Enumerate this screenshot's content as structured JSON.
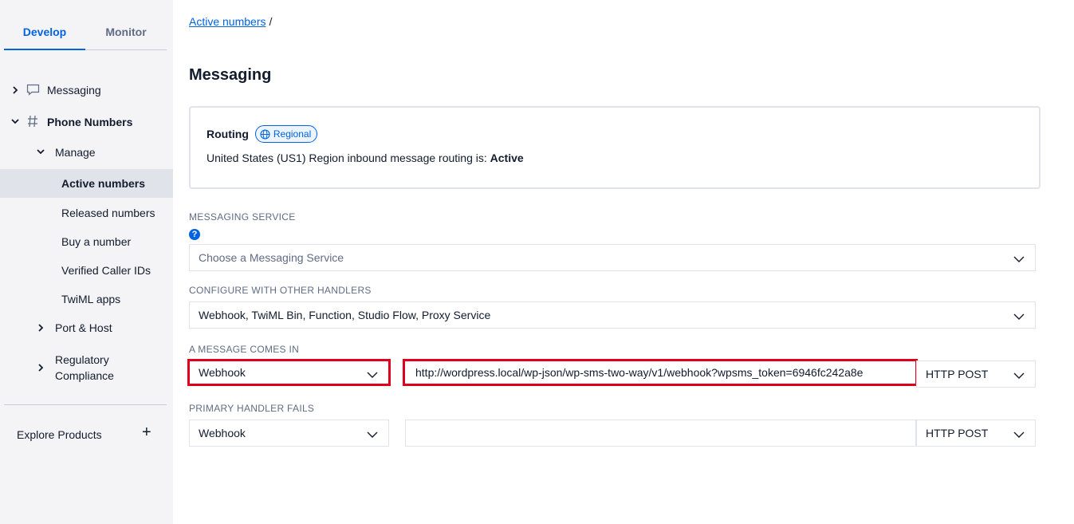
{
  "sidebar": {
    "tabs": [
      {
        "label": "Develop",
        "active": true
      },
      {
        "label": "Monitor",
        "active": false
      }
    ],
    "messaging": "Messaging",
    "phone_numbers": "Phone Numbers",
    "manage": "Manage",
    "active_numbers": "Active numbers",
    "released_numbers": "Released numbers",
    "buy_number": "Buy a number",
    "verified_caller_ids": "Verified Caller IDs",
    "twiml_apps": "TwiML apps",
    "port_host": "Port & Host",
    "regulatory_line1": "Regulatory",
    "regulatory_line2": "Compliance",
    "explore_products": "Explore Products",
    "plus_glyph": "+"
  },
  "breadcrumb": {
    "link": "Active numbers",
    "separator": "/"
  },
  "page_title": "Messaging",
  "routing": {
    "title": "Routing",
    "badge": "Regional",
    "description_prefix": "United States (US1) Region inbound message routing is: ",
    "status": "Active"
  },
  "messaging_service": {
    "label": "MESSAGING SERVICE",
    "help_glyph": "?",
    "placeholder": "Choose a Messaging Service"
  },
  "other_handlers": {
    "label": "CONFIGURE WITH OTHER HANDLERS",
    "value": "Webhook, TwiML Bin, Function, Studio Flow, Proxy Service"
  },
  "message_comes_in": {
    "label": "A MESSAGE COMES IN",
    "type": "Webhook",
    "url": "http://wordpress.local/wp-json/wp-sms-two-way/v1/webhook?wpsms_token=6946fc242a8e",
    "method": "HTTP POST"
  },
  "primary_handler_fails": {
    "label": "PRIMARY HANDLER FAILS",
    "type": "Webhook",
    "url": "",
    "method": "HTTP POST"
  },
  "colors": {
    "accent": "#0263e0",
    "highlight": "#e0001c",
    "sidebar_bg": "#f4f4f6"
  }
}
